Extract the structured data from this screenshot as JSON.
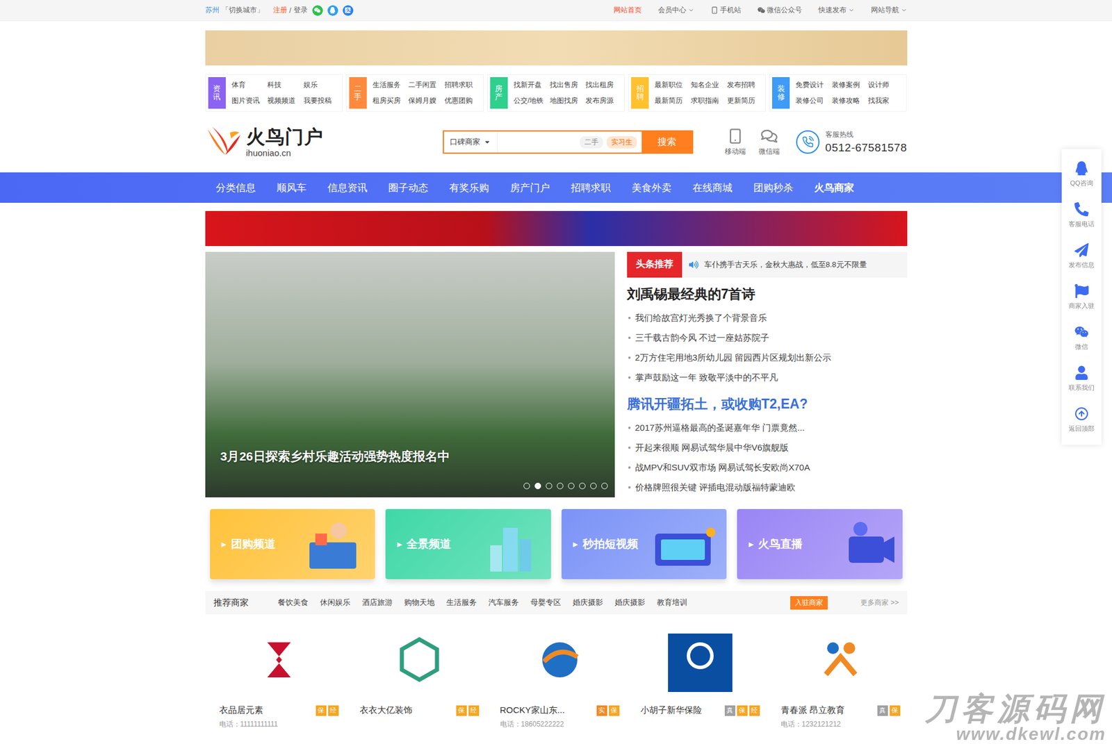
{
  "topbar": {
    "city": "苏州",
    "switch": "「切换城市」",
    "register": "注册",
    "sep": "/",
    "login": "登录",
    "links": [
      {
        "label": "网站首页",
        "selected": true,
        "kind": "link"
      },
      {
        "label": "会员中心",
        "selected": false,
        "kind": "menu"
      },
      {
        "label": "手机站",
        "selected": false,
        "kind": "mobile"
      },
      {
        "label": "微信公众号",
        "selected": false,
        "kind": "official"
      },
      {
        "label": "快速发布",
        "selected": false,
        "kind": "menu"
      },
      {
        "label": "网站导航",
        "selected": false,
        "kind": "menu"
      }
    ]
  },
  "category_nav": [
    {
      "label": "资讯",
      "color": "#8a63f2",
      "links": [
        "体育",
        "科技",
        "娱乐",
        "图片资讯",
        "视频频道",
        "我要投稿"
      ]
    },
    {
      "label": "二手",
      "color": "#ff8a3d",
      "links": [
        "生活服务",
        "二手闲置",
        "招聘求职",
        "租房买房",
        "保姆月嫂",
        "优惠团购"
      ]
    },
    {
      "label": "房产",
      "color": "#2fcf8e",
      "links": [
        "找新开盘",
        "找出售房",
        "找出租房",
        "公交/地铁",
        "地图找房",
        "发布房源"
      ]
    },
    {
      "label": "招聘",
      "color": "#ffc12e",
      "links": [
        "最新职位",
        "知名企业",
        "发布招聘",
        "最新简历",
        "求职指南",
        "更新简历"
      ]
    },
    {
      "label": "装修",
      "color": "#3e9bf6",
      "links": [
        "免费设计",
        "装修案例",
        "设计师",
        "装修公司",
        "装修攻略",
        "找我家"
      ]
    }
  ],
  "header": {
    "logo": {
      "name": "火鸟门户",
      "domain": "ihuoniao.cn"
    },
    "search": {
      "category": "口碑商家",
      "hot": [
        {
          "label": "二手",
          "highlighted": false
        },
        {
          "label": "实习生",
          "highlighted": true
        }
      ],
      "button": "搜索"
    },
    "apps": [
      {
        "label": "移动端",
        "kind": "mobile"
      },
      {
        "label": "微信端",
        "kind": "wechat"
      }
    ],
    "hotline": {
      "label": "客服热线",
      "number": "0512-67581578"
    }
  },
  "nav": [
    {
      "label": "分类信息",
      "bold": false
    },
    {
      "label": "顺风车",
      "bold": false
    },
    {
      "label": "信息资讯",
      "bold": false
    },
    {
      "label": "圈子动态",
      "bold": false
    },
    {
      "label": "有奖乐购",
      "bold": false
    },
    {
      "label": "房产门户",
      "bold": false
    },
    {
      "label": "招聘求职",
      "bold": false
    },
    {
      "label": "美食外卖",
      "bold": false
    },
    {
      "label": "在线商城",
      "bold": false
    },
    {
      "label": "团购秒杀",
      "bold": false
    },
    {
      "label": "火鸟商家",
      "bold": true
    }
  ],
  "slider": {
    "caption": "3月26日探索乡村乐趣活动强势热度报名中",
    "dots": [
      {
        "selected": false
      },
      {
        "selected": true
      },
      {
        "selected": false
      },
      {
        "selected": false
      },
      {
        "selected": false
      },
      {
        "selected": false
      },
      {
        "selected": false
      },
      {
        "selected": false
      }
    ]
  },
  "headlines": {
    "badge": "头条推荐",
    "notice": "车仆携手古天乐，金秋大惠战，低至8.8元不限量",
    "groups": [
      {
        "title": "刘禹锡最经典的7首诗",
        "color": "#222222",
        "items": [
          "我们给故宫灯光秀换了个背景音乐",
          "三千载古韵今风 不过一座姑苏院子",
          "2万方住宅用地3所幼儿园 留园西片区规划出新公示",
          "掌声鼓励这一年 致敬平淡中的不平凡"
        ]
      },
      {
        "title": "腾讯开疆拓土，或收购T2,EA?",
        "color": "#3a6fd8",
        "items": [
          "2017苏州逼格最高的圣诞嘉年华 门票竟然...",
          "开起来很顺 网易试驾华晨中华V6旗舰版",
          "战MPV和SUV双市场 网易试驾长安欧尚X70A",
          "价格牌照很关键 评插电混动版福特蒙迪欧"
        ]
      }
    ]
  },
  "channels": [
    {
      "label": "团购频道",
      "arrow": "▶",
      "color": "#ffc23a"
    },
    {
      "label": "全景频道",
      "arrow": "▶",
      "color": "#3fd8a6"
    },
    {
      "label": "秒拍短视频",
      "arrow": "▶",
      "color": "#7b93f7"
    },
    {
      "label": "火鸟直播",
      "arrow": "▶",
      "color": "#9a85f5"
    }
  ],
  "merchants": {
    "title": "推荐商家",
    "categories": [
      "餐饮美食",
      "休闲娱乐",
      "酒店旅游",
      "购物天地",
      "生活服务",
      "汽车服务",
      "母婴专区",
      "婚庆摄影",
      "婚庆摄影",
      "教育培训"
    ],
    "join": "入驻商家",
    "more": "更多商家 >>",
    "items": [
      {
        "name": "衣品居元素",
        "color": "#c8102e",
        "badges": [
          {
            "label": "保",
            "color": "#f5a623"
          },
          {
            "label": "经",
            "color": "#f5a623"
          }
        ],
        "phone": "电话：11111111111"
      },
      {
        "name": "衣衣大亿装饰",
        "color": "#2e9e7e",
        "badges": [
          {
            "label": "保",
            "color": "#f5a623"
          },
          {
            "label": "经",
            "color": "#f5a623"
          }
        ],
        "phone": ""
      },
      {
        "name": "ROCKY家山东...",
        "color": "#1f6fc4",
        "badges": [
          {
            "label": "实",
            "color": "#f08a24"
          },
          {
            "label": "保",
            "color": "#f5a623"
          }
        ],
        "phone": "电话：18605222222"
      },
      {
        "name": "小胡子新华保险",
        "color": "#0a4ea2",
        "badges": [
          {
            "label": "真",
            "color": "#a0a0a0"
          },
          {
            "label": "保",
            "color": "#f5a623"
          },
          {
            "label": "经",
            "color": "#f5a623"
          }
        ],
        "phone": ""
      },
      {
        "name": "青春派 昂立教育",
        "color": "#f08a24",
        "badges": [
          {
            "label": "真",
            "color": "#a0a0a0"
          },
          {
            "label": "保",
            "color": "#f5a623"
          }
        ],
        "phone": "电话：1232121212"
      }
    ]
  },
  "sidebar": [
    {
      "label": "QQ咨询",
      "kind": "qq"
    },
    {
      "label": "客服电话",
      "kind": "phone"
    },
    {
      "label": "发布信息",
      "kind": "post"
    },
    {
      "label": "商家入驻",
      "kind": "join"
    },
    {
      "label": "微信",
      "kind": "wechat"
    },
    {
      "label": "联系我们",
      "kind": "contact"
    },
    {
      "label": "返回顶部",
      "kind": "top"
    }
  ],
  "watermark": {
    "text": "刀客源码网",
    "url": "www.dkewl.com"
  }
}
